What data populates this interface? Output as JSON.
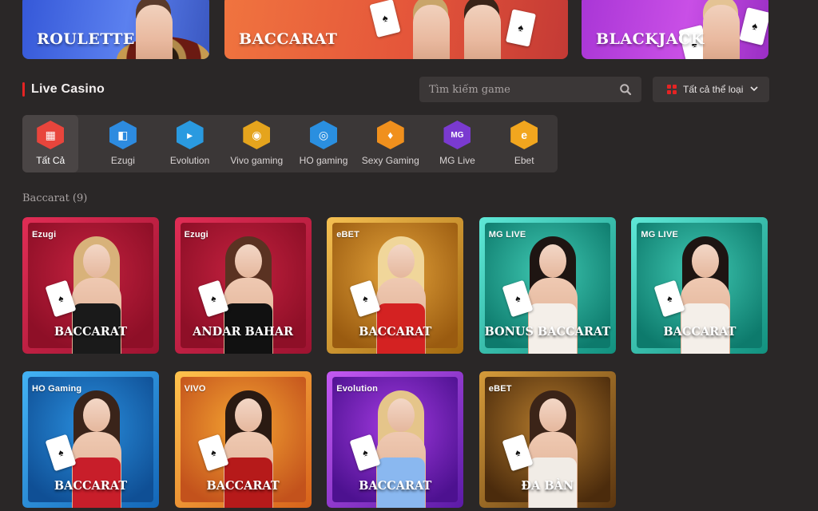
{
  "banners": [
    {
      "title": "ROULETTE"
    },
    {
      "title": "BACCARAT"
    },
    {
      "title": "BLACKJACK"
    }
  ],
  "section": {
    "title": "Live Casino"
  },
  "search": {
    "placeholder": "Tìm kiếm game"
  },
  "filter": {
    "label": "Tất cả thể loại"
  },
  "providers": [
    {
      "label": "Tất Cả",
      "icon": "all-games-icon",
      "color": "#e8453c",
      "active": true
    },
    {
      "label": "Ezugi",
      "icon": "ezugi-icon",
      "color": "#2d8be0"
    },
    {
      "label": "Evolution",
      "icon": "evolution-icon",
      "color": "#2a9ae0"
    },
    {
      "label": "Vivo gaming",
      "icon": "vivo-gaming-icon",
      "color": "#e5a41d"
    },
    {
      "label": "HO gaming",
      "icon": "ho-gaming-icon",
      "color": "#2a8fe0"
    },
    {
      "label": "Sexy Gaming",
      "icon": "sexy-gaming-icon",
      "color": "#f0901d"
    },
    {
      "label": "MG Live",
      "icon": "mg-live-icon",
      "color": "#7a3ad0"
    },
    {
      "label": "Ebet",
      "icon": "ebet-icon",
      "color": "#f2a61e"
    }
  ],
  "category": {
    "label": "Baccarat (9)"
  },
  "games": [
    {
      "name": "BACCARAT",
      "brand": "Ezugi"
    },
    {
      "name": "ANDAR BAHAR",
      "brand": "Ezugi"
    },
    {
      "name": "BACCARAT",
      "brand": "eBET"
    },
    {
      "name": "BONUS BACCARAT",
      "brand": "MG LIVE"
    },
    {
      "name": "BACCARAT",
      "brand": "MG LIVE"
    },
    {
      "name": "BACCARAT",
      "brand": "HO Gaming"
    },
    {
      "name": "BACCARAT",
      "brand": "VIVO"
    },
    {
      "name": "BACCARAT",
      "brand": "Evolution"
    },
    {
      "name": "ĐA BÀN",
      "brand": "eBET"
    }
  ]
}
